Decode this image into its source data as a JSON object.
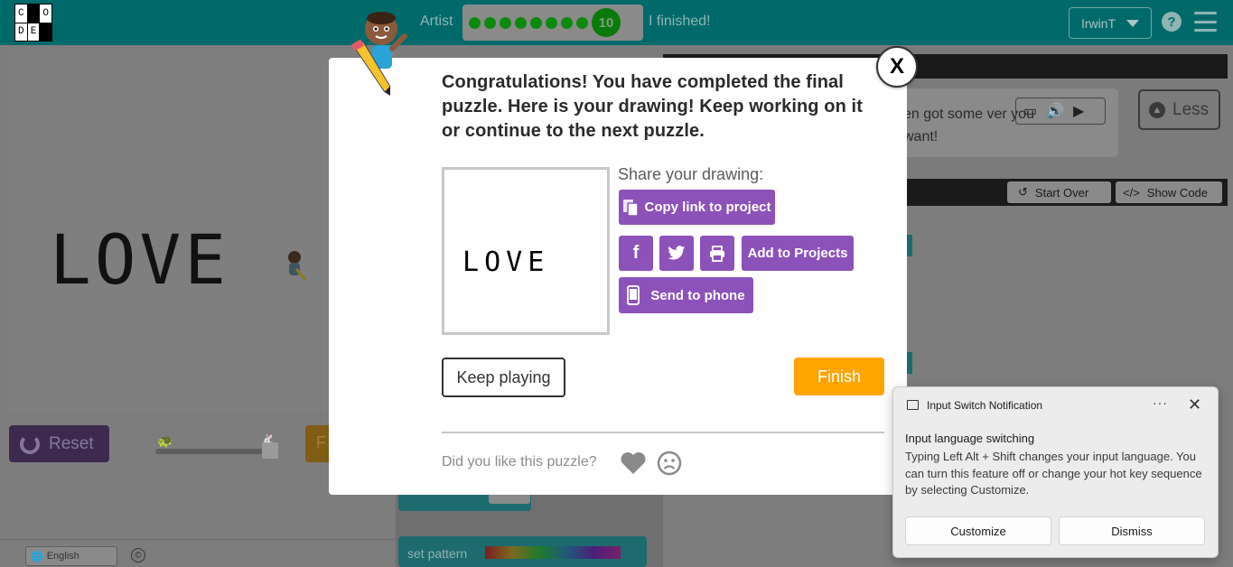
{
  "header": {
    "logo_letters": [
      "C",
      "O",
      "D",
      "E"
    ],
    "stage_name": "Artist",
    "progress": {
      "completed_dots": 8,
      "current_level": "10"
    },
    "finished_link": "I finished!",
    "user_name": "IrwinT",
    "help_label": "?"
  },
  "background": {
    "drawing_text": "LOVE",
    "reset_label": "Reset",
    "run_label": "F",
    "language": "English",
    "copyright": "©",
    "instructions_text": "en got some ver you want!",
    "less_label": "Less",
    "start_over_label": "Start Over",
    "show_code_label": "Show Code",
    "block_label": "set pattern"
  },
  "modal": {
    "close_label": "X",
    "congrats": "Congratulations! You have completed the final puzzle. Here is your drawing! Keep working on it or continue to the next puzzle.",
    "thumb_letters": [
      "L",
      "O",
      "V",
      "E"
    ],
    "share_label": "Share your drawing:",
    "copy_link_label": "Copy link to project",
    "add_to_projects_label": "Add to Projects",
    "send_to_phone_label": "Send to phone",
    "keep_playing_label": "Keep playing",
    "finish_label": "Finish",
    "like_label": "Did you like this puzzle?"
  },
  "toast": {
    "title": "Input Switch Notification",
    "more": "···",
    "close": "✕",
    "heading": "Input language switching",
    "body": "Typing Left Alt + Shift changes your input language. You can turn this feature off or change your hot key sequence by selecting Customize.",
    "customize_label": "Customize",
    "dismiss_label": "Dismiss"
  },
  "colors": {
    "header_bg": "#006a6a",
    "purple": "#8c52ba",
    "orange": "#ffa400"
  }
}
